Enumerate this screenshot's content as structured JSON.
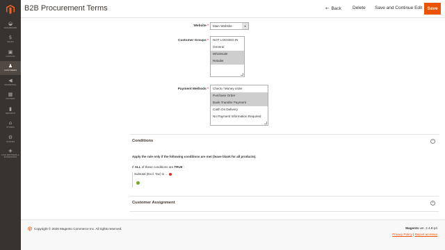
{
  "sidebar": {
    "items": [
      {
        "label": "DASHBOARD",
        "glyph": "◒",
        "active": false
      },
      {
        "label": "SALES",
        "glyph": "$",
        "active": false
      },
      {
        "label": "CATALOG",
        "glyph": "▣",
        "active": false
      },
      {
        "label": "CUSTOMERS",
        "glyph": "♟",
        "active": true
      },
      {
        "label": "MARKETING",
        "glyph": "◀",
        "active": false
      },
      {
        "label": "CONTENT",
        "glyph": "▦",
        "active": false
      },
      {
        "label": "REPORTS",
        "glyph": "▮",
        "active": false
      },
      {
        "label": "STORES",
        "glyph": "⌂",
        "active": false
      },
      {
        "label": "SYSTEM",
        "glyph": "⚙",
        "active": false
      },
      {
        "label": "FIND PARTNERS & EXTENSIONS",
        "glyph": "◈",
        "active": false
      }
    ]
  },
  "header": {
    "title": "B2B Procurement Terms",
    "back_label": "Back",
    "delete_label": "Delete",
    "save_continue_label": "Save and Continue Edit",
    "save_label": "Save"
  },
  "form": {
    "website": {
      "label": "Website",
      "value": "Main Website"
    },
    "customer_groups": {
      "label": "Customer Groups",
      "options": [
        {
          "text": "NOT LOGGED IN",
          "selected": false
        },
        {
          "text": "General",
          "selected": false
        },
        {
          "text": "Wholesale",
          "selected": true
        },
        {
          "text": "Retailer",
          "selected": true
        }
      ]
    },
    "payment_methods": {
      "label": "Payment Methods",
      "options": [
        {
          "text": "Check / Money order",
          "selected": false
        },
        {
          "text": "Purchase Order",
          "selected": true
        },
        {
          "text": "Bank Transfer Payment",
          "selected": true
        },
        {
          "text": "Cash On Delivery",
          "selected": false
        },
        {
          "text": "No Payment Information Required",
          "selected": false
        }
      ]
    }
  },
  "conditions": {
    "title": "Conditions",
    "note": "Apply the rule only if the following conditions are met (leave blank for all products).",
    "combinator_pre": "If",
    "combinator_all": "ALL",
    "combinator_mid": "of these conditions are",
    "combinator_true": "TRUE",
    "combinator_post": ":",
    "rule_text": "Subtotal (Excl. Tax) is",
    "rule_value": "..."
  },
  "customer_assignment": {
    "title": "Customer Assignment"
  },
  "footer": {
    "copyright": "Copyright © 2026 Magento Commerce Inc. All rights reserved.",
    "brand": "Magento",
    "version": "ver. 2.4.8-p4",
    "privacy": "Privacy Policy",
    "separator": "|",
    "report": "Report an Issue"
  },
  "colors": {
    "accent": "#eb5202",
    "sidebar": "#373330",
    "sidebar_active": "#514943"
  }
}
